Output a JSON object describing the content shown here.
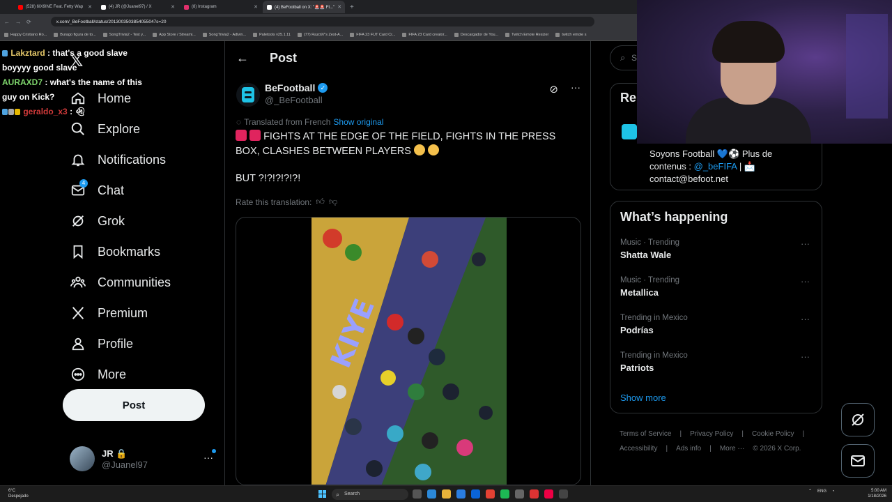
{
  "browser": {
    "tabs": [
      {
        "label": "(528) 6IX9INE Feat. Fetty Wap",
        "color": "#ff0000"
      },
      {
        "label": "(4) JR (@Juanel97) / X",
        "color": "#ffffff"
      },
      {
        "label": "(8) Instagram",
        "color": "#e1306c"
      },
      {
        "label": "(4) BeFootball on X: \"🚨🚨 FI...\"",
        "color": "#ffffff"
      }
    ],
    "new_tab": "+",
    "url": "x.com/_BeFootball/status/2013003503854055047s=20",
    "bookmarks": [
      "Happy Cristiano Ro...",
      "Burago figura de to...",
      "SongTrivia2 - Test y...",
      "App Store / Streami...",
      "SongTrivia2 - Adivin...",
      "Paletools v25.1.11",
      "(77) Razo97's Zest-A...",
      "FIFA 23 FUT Card Cr...",
      "FIFA 23 Card creator...",
      "Descargador de You...",
      "Twitch Emote Resizer",
      "twitch emote s"
    ]
  },
  "chat": [
    {
      "user": "Lakztard",
      "text": ": that's a good slave boyyyy good slave"
    },
    {
      "user": "AURAXD7",
      "text": ": what's the name of this guy on Kick?"
    },
    {
      "user": "geraldo_x3",
      "text": ":"
    }
  ],
  "nav": {
    "items": [
      {
        "label": "Home",
        "icon": "home-icon"
      },
      {
        "label": "Explore",
        "icon": "search-icon"
      },
      {
        "label": "Notifications",
        "icon": "bell-icon"
      },
      {
        "label": "Chat",
        "icon": "mail-icon",
        "badge": "4"
      },
      {
        "label": "Grok",
        "icon": "grok-icon"
      },
      {
        "label": "Bookmarks",
        "icon": "bookmark-icon"
      },
      {
        "label": "Communities",
        "icon": "communities-icon"
      },
      {
        "label": "Premium",
        "icon": "x-icon"
      },
      {
        "label": "Profile",
        "icon": "person-icon"
      },
      {
        "label": "More",
        "icon": "more-circle-icon"
      }
    ],
    "post_label": "Post",
    "account": {
      "name": "JR 🔒",
      "handle": "@Juanel97"
    }
  },
  "post": {
    "header": "Post",
    "author": {
      "name": "BeFootball",
      "handle": "@_BeFootball"
    },
    "translated_label": "Translated from French",
    "show_original": "Show original",
    "text_line1": "FIGHTS AT THE EDGE OF THE FIELD, FIGHTS IN THE PRESS BOX, CLASHES BETWEEN PLAYERS",
    "text_line2": "BUT ?!?!?!?!?!",
    "rate_label": "Rate this translation:"
  },
  "right": {
    "search_placeholder": "S",
    "relevant_title": "Rel",
    "bio_prefix": "Soyons Football 💙⚽ Plus de contenus :",
    "bio_link": "@_beFIFA",
    "bio_suffix": "| 📩 contact@befoot.net",
    "happening_title": "What’s happening",
    "trends": [
      {
        "category": "Music · Trending",
        "name": "Shatta Wale"
      },
      {
        "category": "Music · Trending",
        "name": "Metallica"
      },
      {
        "category": "Trending in Mexico",
        "name": "Podrías"
      },
      {
        "category": "Trending in Mexico",
        "name": "Patriots"
      }
    ],
    "show_more": "Show more",
    "footer_row1": [
      "Terms of Service",
      "|",
      "Privacy Policy",
      "|",
      "Cookie Policy",
      "|"
    ],
    "footer_row2": [
      "Accessibility",
      "|",
      "Ads info",
      "|",
      "More ···",
      "© 2026 X Corp."
    ]
  },
  "taskbar": {
    "weather_temp": "6°C",
    "weather_desc": "Despejado",
    "search_label": "Search",
    "lang": "ENG",
    "time": "5:00 AM",
    "date": "1/18/2026"
  },
  "colors": {
    "accent": "#1d9bf0",
    "background": "#000000",
    "border": "#2f3336"
  }
}
